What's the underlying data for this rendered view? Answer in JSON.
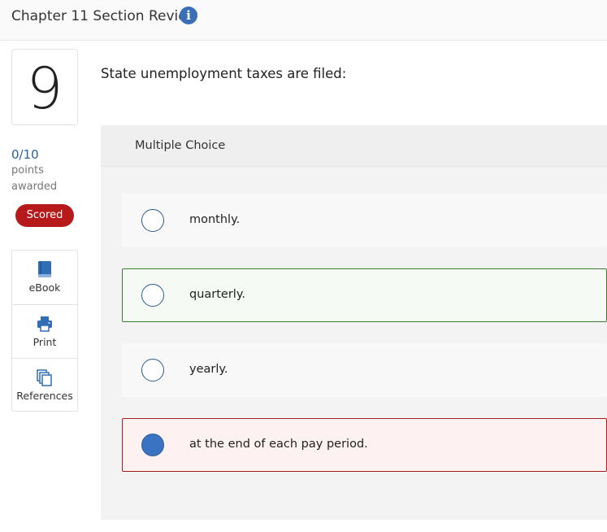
{
  "header": {
    "title": "Chapter 11 Section Review",
    "info_icon": "info-icon",
    "info_glyph": "i"
  },
  "question_panel": {
    "number": "9",
    "score": "0/10",
    "points_label": "points",
    "awarded_label": "awarded",
    "status_badge": "Scored"
  },
  "tools": [
    {
      "label": "eBook",
      "icon": "book-icon"
    },
    {
      "label": "Print",
      "icon": "printer-icon"
    },
    {
      "label": "References",
      "icon": "references-icon"
    }
  ],
  "question": {
    "text": "State unemployment taxes are filed:",
    "type_label": "Multiple Choice"
  },
  "options": [
    {
      "text": "monthly.",
      "selected": false,
      "state": "none"
    },
    {
      "text": "quarterly.",
      "selected": false,
      "state": "correct"
    },
    {
      "text": "yearly.",
      "selected": false,
      "state": "none"
    },
    {
      "text": "at the end of each pay period.",
      "selected": true,
      "state": "incorrect"
    }
  ],
  "colors": {
    "accent_blue": "#3a6fb6",
    "scored_badge": "#b71a1a",
    "correct_border": "#3f7a36",
    "incorrect_border": "#a71d1d",
    "selected_radio": "#3a73c1"
  }
}
